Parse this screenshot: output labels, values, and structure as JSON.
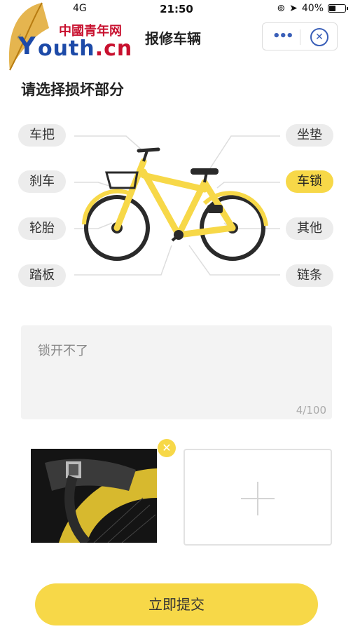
{
  "status_bar": {
    "carrier": "4G",
    "time": "21:50",
    "battery": "40%",
    "battery_level": 0.4
  },
  "nav": {
    "title": "报修车辆",
    "back_icon": "chevron-left-icon",
    "more_icon": "more-dots-icon",
    "close_icon": "close-circle-icon"
  },
  "watermark": {
    "badge": "中國青年网",
    "youth": "outh",
    "domain": ".cn",
    "initial": "Y"
  },
  "section_title": "请选择损坏部分",
  "parts": [
    {
      "label": "车把",
      "selected": false
    },
    {
      "label": "刹车",
      "selected": false
    },
    {
      "label": "轮胎",
      "selected": false
    },
    {
      "label": "踏板",
      "selected": false
    },
    {
      "label": "坐垫",
      "selected": false
    },
    {
      "label": "车锁",
      "selected": true
    },
    {
      "label": "其他",
      "selected": false
    },
    {
      "label": "链条",
      "selected": false
    }
  ],
  "description": {
    "value": "锁开不了",
    "count": "4/100"
  },
  "photo_upload": {
    "remove_icon": "close-icon",
    "add_icon": "plus-icon"
  },
  "submit_label": "立即提交",
  "colors": {
    "accent": "#f7d848",
    "link": "#1a73e8",
    "pill_bg": "#ececec"
  }
}
